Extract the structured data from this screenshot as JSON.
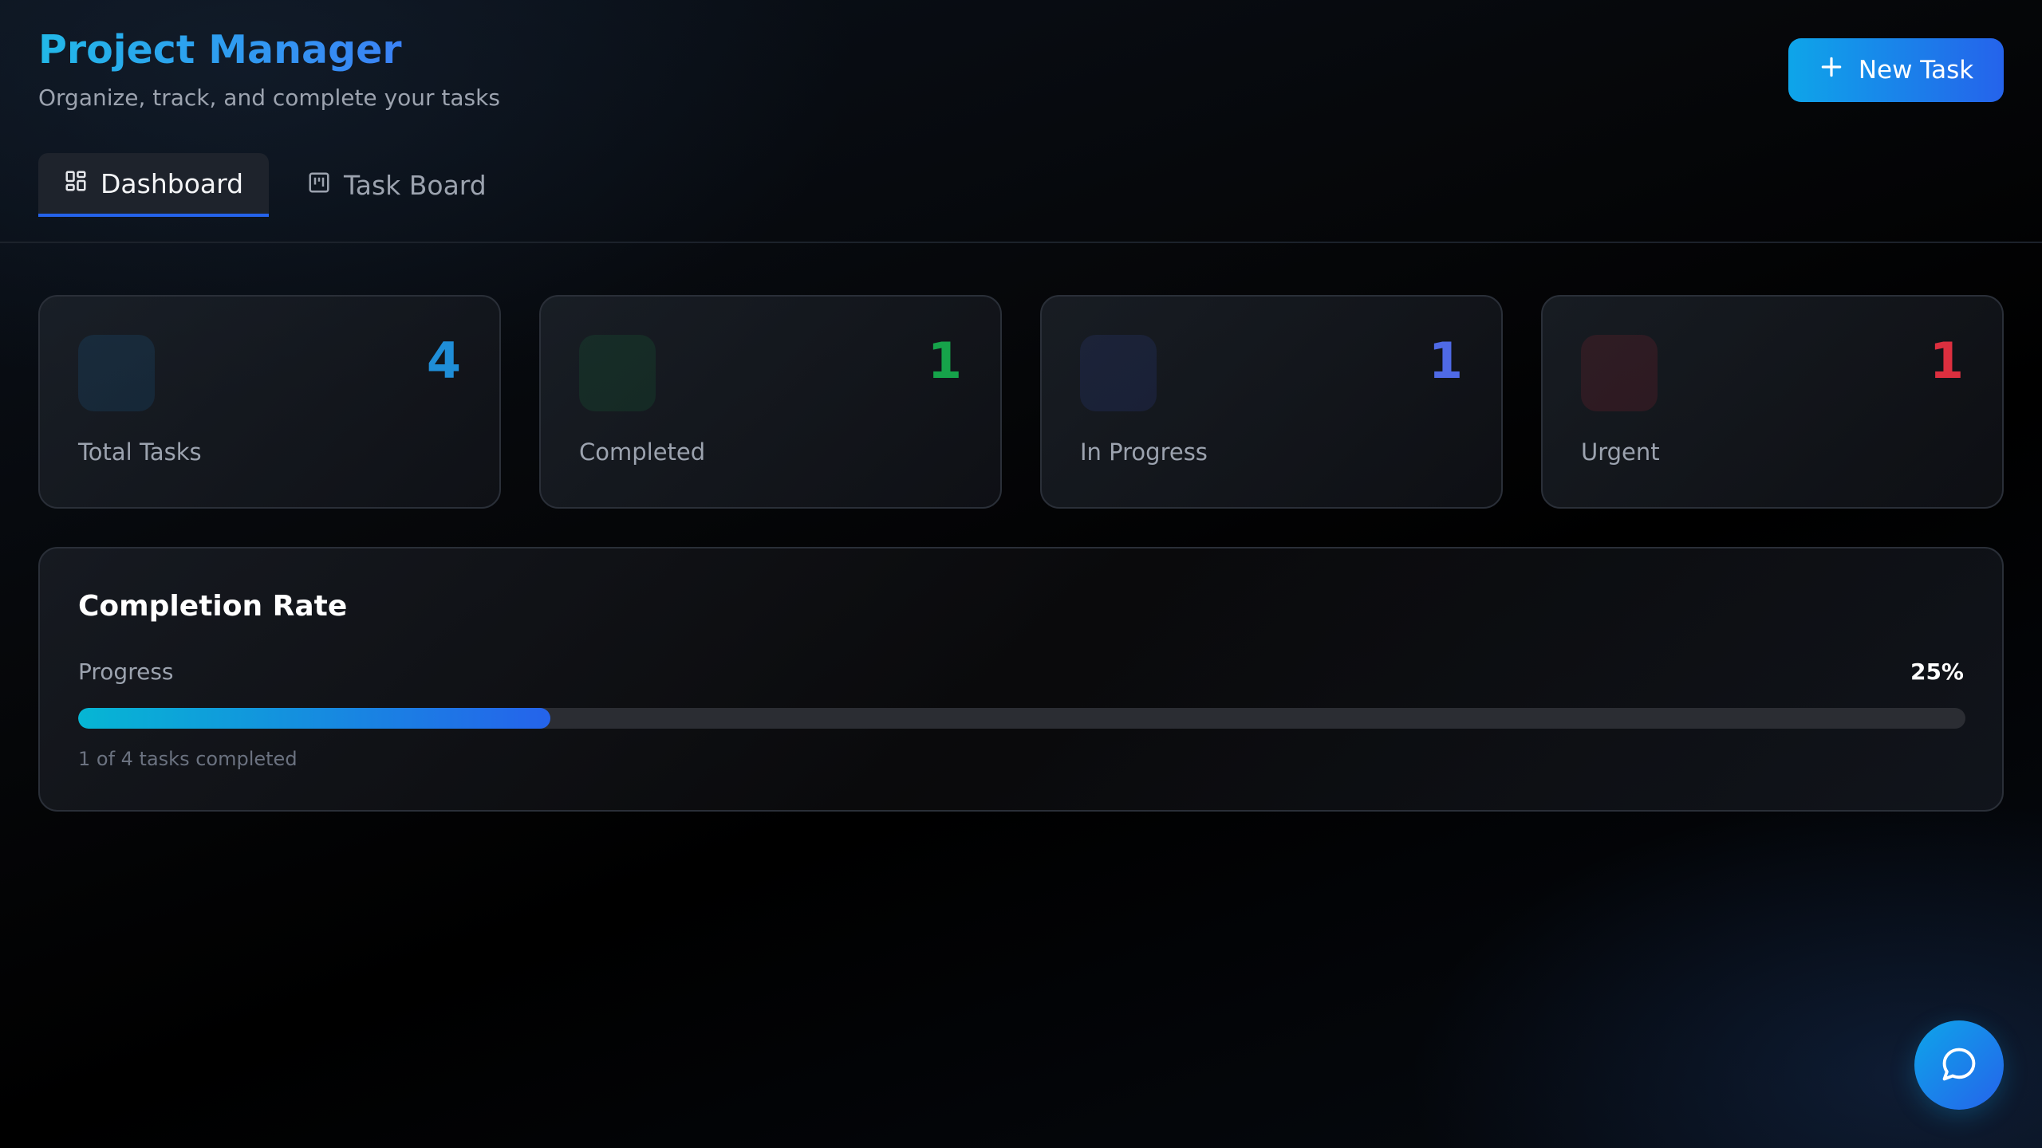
{
  "header": {
    "title": "Project Manager",
    "subtitle": "Organize, track, and complete your tasks",
    "new_task_label": "New Task"
  },
  "tabs": [
    {
      "label": "Dashboard",
      "icon": "dashboard-grid-icon",
      "active": true
    },
    {
      "label": "Task Board",
      "icon": "kanban-board-icon",
      "active": false
    }
  ],
  "stats": [
    {
      "value": "4",
      "label": "Total Tasks",
      "color": "#1f8ed8"
    },
    {
      "value": "1",
      "label": "Completed",
      "color": "#16a34a"
    },
    {
      "value": "1",
      "label": "In Progress",
      "color": "#4f6ae6"
    },
    {
      "value": "1",
      "label": "Urgent",
      "color": "#dc2f3f"
    }
  ],
  "completion": {
    "title": "Completion Rate",
    "progress_label": "Progress",
    "percent_text": "25%",
    "percent": 25,
    "caption": "1 of 4 tasks completed"
  },
  "colors": {
    "accent_start": "#0ea5e9",
    "accent_end": "#2563eb"
  },
  "fab": {
    "icon": "chat-bubble-icon"
  }
}
